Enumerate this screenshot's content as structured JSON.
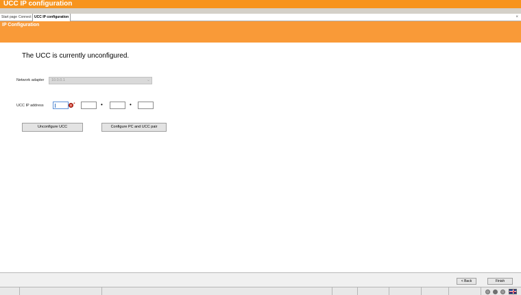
{
  "window": {
    "title": "UCC IP configuration"
  },
  "tabs": [
    {
      "label": "Start page"
    },
    {
      "label": "Connect"
    },
    {
      "label": "UCC IP configuration"
    }
  ],
  "tab_close_glyph": "×",
  "header": {
    "title": "IP Configuration"
  },
  "main": {
    "status_message": "The UCC is currently unconfigured.",
    "network_adapter": {
      "label": "Network adapter",
      "value": "10.0.0.1",
      "chevron": "⌄",
      "disabled": true
    },
    "ucc_ip": {
      "label": "UCC IP address",
      "octets": [
        "",
        "",
        "",
        ""
      ],
      "separator": "•",
      "error_mark": "*",
      "error_icon": "error-icon"
    },
    "buttons": {
      "unconfigure": "Unconfigure UCC",
      "configure_pair": "Configure PC and UCC pair"
    }
  },
  "footer": {
    "back_label": "< Back",
    "finish_label": "Finish"
  },
  "colors": {
    "accent": "#f7941d",
    "header_band": "#f99a38",
    "error": "#d83a2a"
  }
}
